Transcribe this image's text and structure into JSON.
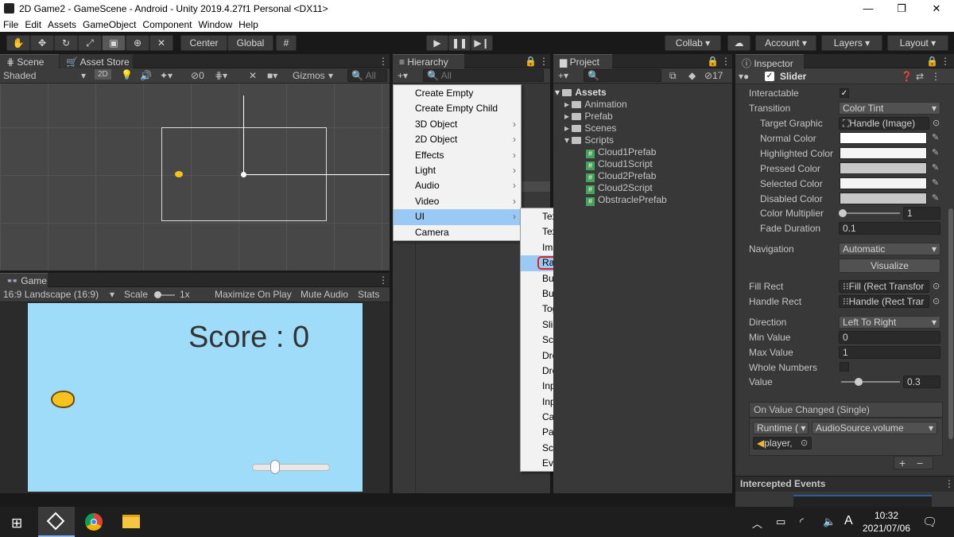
{
  "window": {
    "title": "2D Game2 - GameScene - Android - Unity 2019.4.27f1 Personal <DX11>",
    "minimize": "—",
    "maximize": "❐",
    "close": "✕"
  },
  "menubar": [
    "File",
    "Edit",
    "Assets",
    "GameObject",
    "Component",
    "Window",
    "Help"
  ],
  "toolbar": {
    "pivot": "Center",
    "space": "Global",
    "collab": "Collab",
    "account": "Account",
    "layers": "Layers",
    "layout": "Layout"
  },
  "scene": {
    "tab_scene": "Scene",
    "tab_asset_store": "Asset Store",
    "shading": "Shaded",
    "mode_2d": "2D",
    "hidden_count": "0",
    "gizmos": "Gizmos",
    "search_all": "All"
  },
  "game": {
    "tab": "Game",
    "resolution": "16:9 Landscape (16:9)",
    "scale_label": "Scale",
    "scale_value": "1x",
    "maximize": "Maximize On Play",
    "mute": "Mute Audio",
    "stats": "Stats",
    "score": "Score : 0",
    "volume_value": 0.3
  },
  "hierarchy": {
    "tab": "Hierarchy",
    "add": "+▾",
    "search_all": "All"
  },
  "context_menu": [
    {
      "label": "Create Empty",
      "sub": false
    },
    {
      "label": "Create Empty Child",
      "sub": false
    },
    {
      "label": "3D Object",
      "sub": true
    },
    {
      "label": "2D Object",
      "sub": true
    },
    {
      "label": "Effects",
      "sub": true
    },
    {
      "label": "Light",
      "sub": true
    },
    {
      "label": "Audio",
      "sub": true
    },
    {
      "label": "Video",
      "sub": true
    },
    {
      "label": "UI",
      "sub": true,
      "highlighted": true
    },
    {
      "label": "Camera",
      "sub": false
    }
  ],
  "ui_submenu": [
    "Text",
    "Text - TextMeshPro",
    "Image",
    "Raw Image",
    "Button",
    "Button - TextMeshPro",
    "Toggle",
    "Slider",
    "Scrollbar",
    "Dropdown",
    "Dropdown - TextMeshPro",
    "Input Field",
    "Input Field - TextMeshPro",
    "Canvas",
    "Panel",
    "Scroll View",
    "Event System"
  ],
  "ui_submenu_highlight": "Raw Image",
  "project": {
    "tab": "Project",
    "hidden_count": "17",
    "assets": "Assets",
    "folders": [
      "Animation",
      "Prefab",
      "Scenes",
      "Scripts"
    ],
    "scripts": [
      "Cloud1Prefab",
      "Cloud1Script",
      "Cloud2Prefab",
      "Cloud2Script",
      "ObstraclePrefab"
    ]
  },
  "inspector": {
    "tab": "Inspector",
    "component": "Slider",
    "interactable": "Interactable",
    "transition": "Transition",
    "transition_value": "Color Tint",
    "target_graphic": "Target Graphic",
    "target_graphic_value": "Handle (Image)",
    "normal_color": "Normal Color",
    "highlighted_color": "Highlighted Color",
    "pressed_color": "Pressed Color",
    "selected_color": "Selected Color",
    "disabled_color": "Disabled Color",
    "color_multiplier": "Color Multiplier",
    "color_multiplier_value": "1",
    "fade_duration": "Fade Duration",
    "fade_duration_value": "0.1",
    "navigation": "Navigation",
    "navigation_value": "Automatic",
    "visualize": "Visualize",
    "fill_rect": "Fill Rect",
    "fill_rect_value": "Fill (Rect Transfor",
    "handle_rect": "Handle Rect",
    "handle_rect_value": "Handle (Rect Trar",
    "direction": "Direction",
    "direction_value": "Left To Right",
    "min_value": "Min Value",
    "min_value_value": "0",
    "max_value": "Max Value",
    "max_value_value": "1",
    "whole_numbers": "Whole Numbers",
    "value": "Value",
    "value_value": "0.3",
    "event_title": "On Value Changed (Single)",
    "event_mode": "Runtime (",
    "event_func": "AudioSource.volume",
    "event_target": "player",
    "plus": "+",
    "minus": "−",
    "intercepted": "Intercepted Events",
    "colors": {
      "normal": "#ffffff",
      "highlighted": "#f5f5f5",
      "pressed": "#c8c8c8",
      "selected": "#f5f5f5",
      "disabled": "#c8c8c8"
    }
  },
  "taskbar": {
    "time": "10:32",
    "date": "2021/07/06",
    "ime": "A"
  }
}
